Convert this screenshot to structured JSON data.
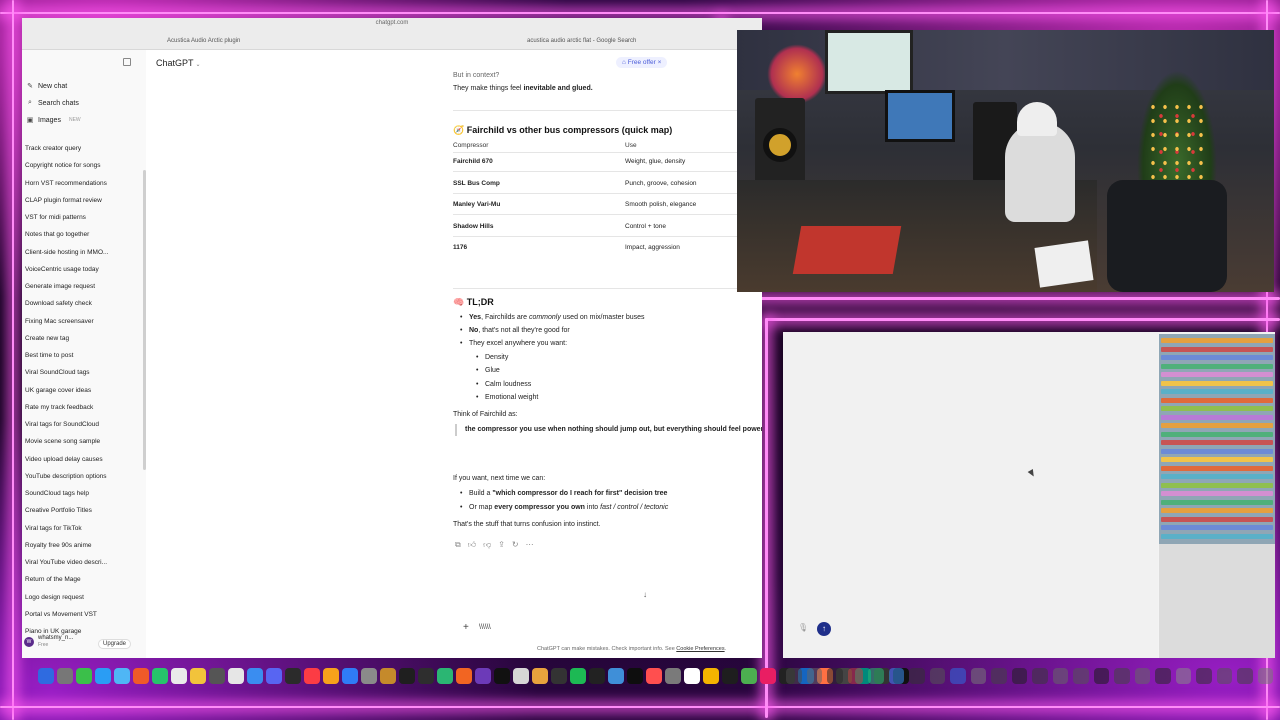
{
  "browser": {
    "url": "chatgpt.com",
    "tabs": [
      "Acustica Audio Arctic plugin",
      "acustica audio arctic flat - Google Search"
    ]
  },
  "sidebar": {
    "top": [
      {
        "icon": "new-chat-icon",
        "label": "New chat"
      },
      {
        "icon": "search-icon",
        "label": "Search chats"
      },
      {
        "icon": "images-icon",
        "label": "Images",
        "badge": "NEW"
      }
    ],
    "chats": [
      "Track creator query",
      "Copyright notice for songs",
      "Horn VST recommendations",
      "CLAP plugin format review",
      "VST for midi patterns",
      "Notes that go together",
      "Client-side hosting in MMO...",
      "VoiceCentric usage today",
      "Generate image request",
      "Download safety check",
      "Fixing Mac screensaver",
      "Create new tag",
      "Best time to post",
      "Viral SoundCloud tags",
      "UK garage cover ideas",
      "Rate my track feedback",
      "Viral tags for SoundCloud",
      "Movie scene song sample",
      "Video upload delay causes",
      "YouTube description options",
      "SoundCloud tags help",
      "Creative Portfolio Titles",
      "Viral tags for TikTok",
      "Royalty free 90s anime",
      "Viral YouTube video descri...",
      "Return of the Mage",
      "Logo design request",
      "Portal vs Movement VST",
      "Piano in UK garage"
    ],
    "user": {
      "initials": "W",
      "name": "whatsmy_n...",
      "plan": "Free"
    },
    "upgrade_label": "Upgrade"
  },
  "header": {
    "model": "ChatGPT",
    "free_offer": "Free offer",
    "free_offer_close": "×"
  },
  "conversation": {
    "intro_line1": "But in context?",
    "intro_line2_pre": "They make things feel ",
    "intro_line2_bold": "inevitable and glued.",
    "map_heading": "🧭 Fairchild vs other bus compressors (quick map)",
    "table_headers": [
      "Compressor",
      "Use"
    ],
    "table_rows": [
      [
        "Fairchild 670",
        "Weight, glue, density"
      ],
      [
        "SSL Bus Comp",
        "Punch, groove, cohesion"
      ],
      [
        "Manley Vari-Mu",
        "Smooth polish, elegance"
      ],
      [
        "Shadow Hills",
        "Control + tone"
      ],
      [
        "1176",
        "Impact, aggression"
      ]
    ],
    "tldr_heading": "🧠 TL;DR",
    "bullet1_bold": "Yes",
    "bullet1_mid": ", Fairchilds are ",
    "bullet1_italic": "commonly",
    "bullet1_end": " used on mix/master buses",
    "bullet2_bold": "No",
    "bullet2_end": ", that's not all they're good for",
    "bullet3": "They excel anywhere you want:",
    "sub_bullets": [
      "Density",
      "Glue",
      "Calm loudness",
      "Emotional weight"
    ],
    "think_of": "Think of Fairchild as:",
    "quote": "the compressor you use when nothing should jump out, but everything should feel powerful",
    "next_time": "If you want, next time we can:",
    "next1_pre": "Build a ",
    "next1_bold": "\"which compressor do I reach for first\" decision tree",
    "next2_pre": "Or map ",
    "next2_bold": "every compressor you own",
    "next2_mid": " into ",
    "next2_italic": "fast / control / tectonic",
    "closing": "That's the stuff that turns confusion into instinct."
  },
  "composer": {
    "plus": "+",
    "value": "\\\\\\\\\\\\"
  },
  "disclaimer": {
    "text": "ChatGPT can make mistakes. Check important info. See ",
    "link": "Cookie Preferences",
    "end": "."
  },
  "daw": {
    "send_icon": "↑",
    "mic_icon": "🎙"
  },
  "dock_colors": [
    "#2f6be0",
    "#777",
    "#3bbf4a",
    "#2a9df4",
    "#4fb6f5",
    "#f05a28",
    "#27c46b",
    "#eaeaea",
    "#f2c33b",
    "#555",
    "#e6e6e6",
    "#3a8df0",
    "#5865f2",
    "#2b2b2b",
    "#fc3c44",
    "#f7a21b",
    "#2f7cf6",
    "#8a8a8a",
    "#c58a2b",
    "#1f1f1f",
    "#2e2e2e",
    "#2bb673",
    "#f26522",
    "#6c3ab8",
    "#111",
    "#d6d6d6",
    "#e8a33d",
    "#333",
    "#1db954",
    "#222",
    "#3f8fd8",
    "#0e0e0e",
    "#ff4f4f",
    "#7a7a7a",
    "#ffffff",
    "#f4b400",
    "#1e1e1e",
    "#4caf50",
    "#e91e63",
    "#222",
    "#1565c0",
    "#ff7043",
    "#444",
    "#00897b",
    "#333",
    "#111"
  ],
  "dock2_colors": [
    "#4a4a4a",
    "#666",
    "#2a2a2a",
    "#c04040",
    "#2bb673",
    "#3a8df0",
    "#333",
    "#555",
    "#2f6be0",
    "#777",
    "#444",
    "#222",
    "#3a3a3a",
    "#666",
    "#555",
    "#1e1e1e",
    "#444",
    "#666",
    "#2a2a2a",
    "#888",
    "#333",
    "#555",
    "#444",
    "#777"
  ],
  "track_colors": [
    "#e4a040",
    "#c75454",
    "#6c8bd6",
    "#4fb07a",
    "#d38fd1",
    "#f0c34a",
    "#5ab0c8",
    "#e06a3b",
    "#8fbf4f",
    "#b77bd6",
    "#e4a040",
    "#4fb07a",
    "#c75454",
    "#6c8bd6",
    "#f0c34a",
    "#e06a3b",
    "#5ab0c8",
    "#8fbf4f",
    "#d38fd1",
    "#4fb07a",
    "#e4a040",
    "#c75454",
    "#6c8bd6",
    "#5ab0c8"
  ]
}
